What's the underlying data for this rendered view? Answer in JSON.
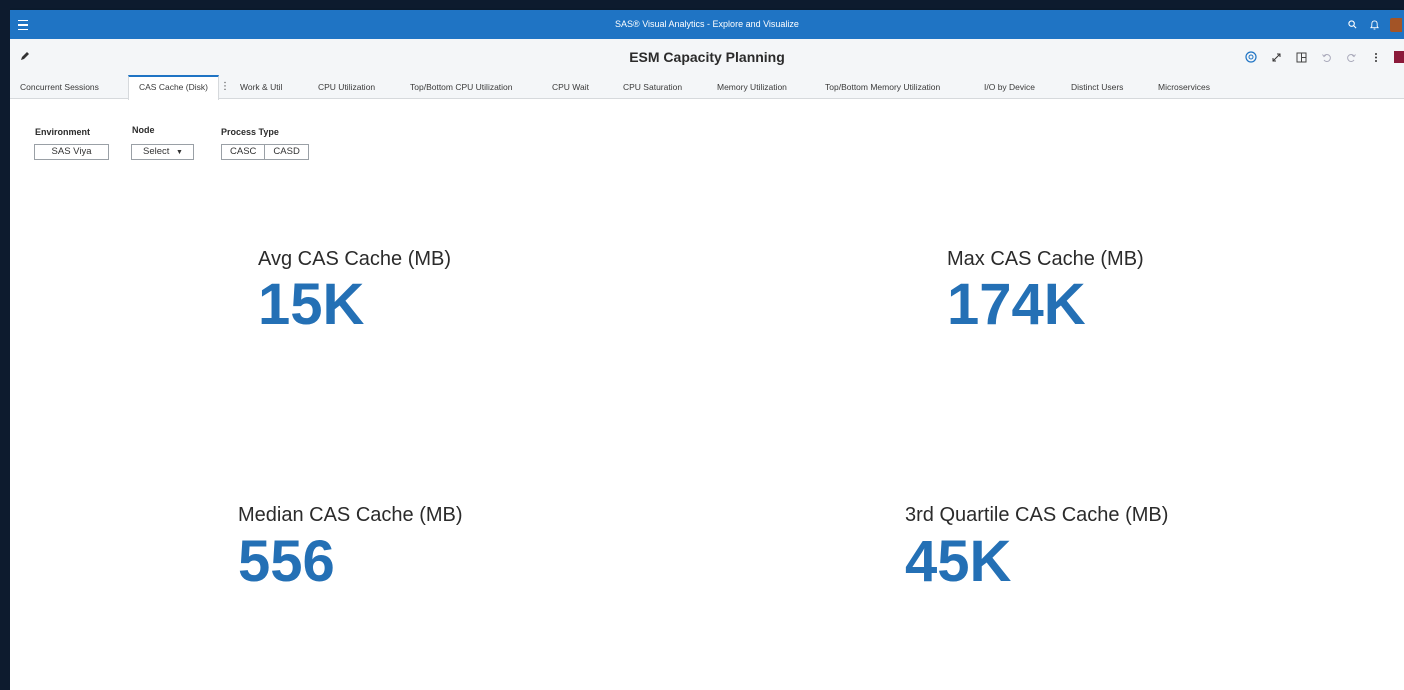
{
  "app": {
    "title": "SAS® Visual Analytics - Explore and Visualize"
  },
  "report": {
    "title": "ESM Capacity Planning"
  },
  "tabs": [
    {
      "label": "Concurrent Sessions"
    },
    {
      "label": "CAS Cache (Disk)",
      "active": true
    },
    {
      "label": "Work & Util"
    },
    {
      "label": "CPU Utilization"
    },
    {
      "label": "Top/Bottom CPU Utilization"
    },
    {
      "label": "CPU Wait"
    },
    {
      "label": "CPU Saturation"
    },
    {
      "label": "Memory Utilization"
    },
    {
      "label": "Top/Bottom Memory Utilization"
    },
    {
      "label": "I/O by Device"
    },
    {
      "label": "Distinct Users"
    },
    {
      "label": "Microservices"
    }
  ],
  "filters": {
    "environment": {
      "label": "Environment",
      "value": "SAS Viya"
    },
    "node": {
      "label": "Node",
      "value": "Select"
    },
    "process_type": {
      "label": "Process Type",
      "options": [
        "CASC",
        "CASD"
      ]
    }
  },
  "kpis": [
    {
      "label": "Avg CAS Cache (MB)",
      "value": "15K"
    },
    {
      "label": "Max CAS Cache (MB)",
      "value": "174K"
    },
    {
      "label": "Median CAS Cache (MB)",
      "value": "556"
    },
    {
      "label": "3rd Quartile CAS Cache (MB)",
      "value": "45K"
    }
  ],
  "colors": {
    "titlebar": "#1f74c4",
    "kpi_value": "#2470b5",
    "brand": "#8b1a3a"
  },
  "icons": {
    "titlebar": [
      "menu-icon",
      "search-icon",
      "notification-bell-icon"
    ],
    "report_tools": [
      "help-icon",
      "expand-icon",
      "panel-icon",
      "undo-icon",
      "redo-icon",
      "more-options-icon"
    ]
  }
}
